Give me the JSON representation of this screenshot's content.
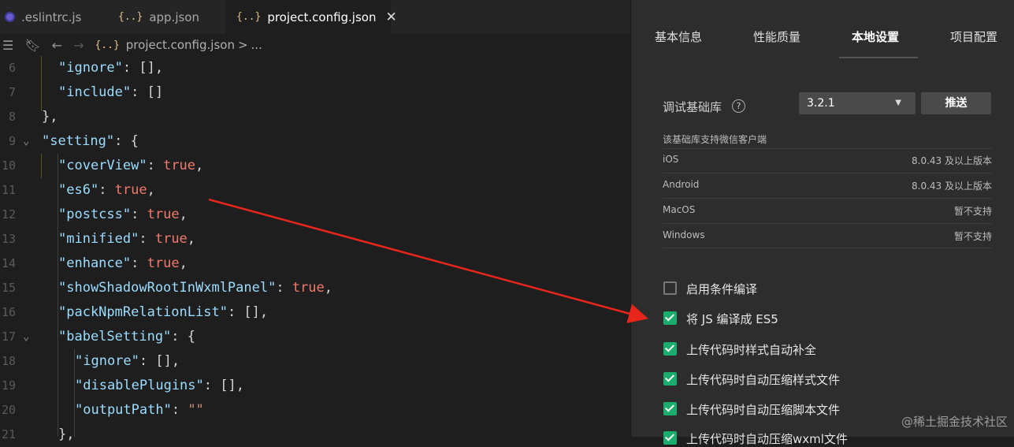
{
  "tabs": [
    {
      "icon": "eslint-icon",
      "label": ".eslintrc.js"
    },
    {
      "icon": "json-braces-icon",
      "label": "app.json"
    },
    {
      "icon": "json-braces-icon",
      "label": "project.config.json",
      "active": true
    }
  ],
  "breadcrumb": {
    "file": "project.config.json",
    "sep": ">",
    "rest": "..."
  },
  "code_lines": [
    {
      "n": "6",
      "parts": [
        [
          "k",
          "\"ignore\""
        ],
        [
          "p",
          ": [],"
        ]
      ]
    },
    {
      "n": "7",
      "parts": [
        [
          "k",
          "\"include\""
        ],
        [
          "p",
          ": []"
        ]
      ]
    },
    {
      "n": "8",
      "parts": [
        [
          "p",
          "},"
        ]
      ]
    },
    {
      "n": "9",
      "fold": true,
      "parts": [
        [
          "k",
          "\"setting\""
        ],
        [
          "p",
          ": {"
        ]
      ]
    },
    {
      "n": "10",
      "parts": [
        [
          "k",
          "\"coverView\""
        ],
        [
          "p",
          ": "
        ],
        [
          "t",
          "true"
        ],
        [
          "p",
          ","
        ]
      ]
    },
    {
      "n": "11",
      "parts": [
        [
          "k",
          "\"es6\""
        ],
        [
          "p",
          ": "
        ],
        [
          "t",
          "true"
        ],
        [
          "p",
          ","
        ]
      ]
    },
    {
      "n": "12",
      "parts": [
        [
          "k",
          "\"postcss\""
        ],
        [
          "p",
          ": "
        ],
        [
          "t",
          "true"
        ],
        [
          "p",
          ","
        ]
      ]
    },
    {
      "n": "13",
      "parts": [
        [
          "k",
          "\"minified\""
        ],
        [
          "p",
          ": "
        ],
        [
          "t",
          "true"
        ],
        [
          "p",
          ","
        ]
      ]
    },
    {
      "n": "14",
      "parts": [
        [
          "k",
          "\"enhance\""
        ],
        [
          "p",
          ": "
        ],
        [
          "t",
          "true"
        ],
        [
          "p",
          ","
        ]
      ]
    },
    {
      "n": "15",
      "parts": [
        [
          "k",
          "\"showShadowRootInWxmlPanel\""
        ],
        [
          "p",
          ": "
        ],
        [
          "t",
          "true"
        ],
        [
          "p",
          ","
        ]
      ]
    },
    {
      "n": "16",
      "parts": [
        [
          "k",
          "\"packNpmRelationList\""
        ],
        [
          "p",
          ": [],"
        ]
      ]
    },
    {
      "n": "17",
      "fold": true,
      "parts": [
        [
          "k",
          "\"babelSetting\""
        ],
        [
          "p",
          ": {"
        ]
      ]
    },
    {
      "n": "18",
      "parts": [
        [
          "k",
          "\"ignore\""
        ],
        [
          "p",
          ": [],"
        ]
      ]
    },
    {
      "n": "19",
      "parts": [
        [
          "k",
          "\"disablePlugins\""
        ],
        [
          "p",
          ": [],"
        ]
      ]
    },
    {
      "n": "20",
      "parts": [
        [
          "k",
          "\"outputPath\""
        ],
        [
          "p",
          ": "
        ],
        [
          "s",
          "\"\""
        ]
      ]
    },
    {
      "n": "21",
      "parts": [
        [
          "p",
          "},"
        ]
      ]
    }
  ],
  "panel": {
    "tabs": [
      "基本信息",
      "性能质量",
      "本地设置",
      "项目配置"
    ],
    "active_tab": "本地设置",
    "debug_lib_label": "调试基础库",
    "help_icon": "?",
    "version": "3.2.1",
    "push_button": "推送",
    "support_title": "该基础库支持微信客户端",
    "platforms": [
      {
        "name": "iOS",
        "value": "8.0.43 及以上版本"
      },
      {
        "name": "Android",
        "value": "8.0.43 及以上版本"
      },
      {
        "name": "MacOS",
        "value": "暂不支持"
      },
      {
        "name": "Windows",
        "value": "暂不支持"
      }
    ],
    "options": [
      {
        "label": "启用条件编译",
        "checked": false
      },
      {
        "label": "将 JS 编译成 ES5",
        "checked": true
      },
      {
        "label": "上传代码时样式自动补全",
        "checked": true
      },
      {
        "label": "上传代码时自动压缩样式文件",
        "checked": true
      },
      {
        "label": "上传代码时自动压缩脚本文件",
        "checked": true
      },
      {
        "label": "上传代码时自动压缩wxml文件",
        "checked": true
      }
    ],
    "watermark": "@稀土掘金技术社区"
  },
  "colors": {
    "accent_green": "#1aad6d",
    "arrow_red": "#e8261c",
    "key_blue": "#9cdcfe",
    "bool_red": "#f27a6d"
  }
}
